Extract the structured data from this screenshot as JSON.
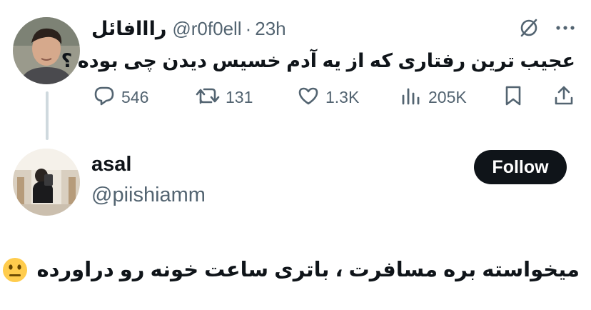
{
  "original_tweet": {
    "display_name": "رااافائل",
    "handle": "@r0f0ell",
    "separator": "·",
    "time": "23h",
    "text": "عجیب ترین رفتاری که از یه آدم خسیس دیدن چی بوده ؟",
    "stats": {
      "replies": "546",
      "retweets": "131",
      "likes": "1.3K",
      "views": "205K"
    },
    "icons": [
      "grok-icon",
      "more-icon",
      "reply-icon",
      "retweet-icon",
      "like-icon",
      "views-icon",
      "bookmark-icon",
      "share-icon"
    ]
  },
  "reply_tweet": {
    "display_name": "asal",
    "handle": "@piishiamm",
    "follow_label": "Follow",
    "text": "میخواسته بره مسافرت ، باتری ساعت خونه رو دراورده",
    "emoji": "neutral-face-emoji"
  },
  "colors": {
    "text_primary": "#0f1419",
    "text_secondary": "#536471",
    "thread_line": "#cfd9de",
    "follow_bg": "#0f1419",
    "emoji_yellow": "#ffcc4d"
  }
}
